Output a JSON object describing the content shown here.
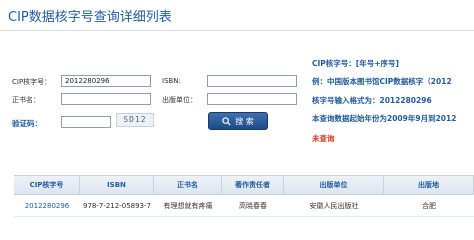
{
  "page": {
    "title": "CIP数据核字号查询详细列表"
  },
  "form": {
    "cip_label": "CIP核字号：",
    "cip_value": "2012280296",
    "isbn_label": "ISBN:",
    "isbn_value": "",
    "title_label": "正书名：",
    "title_value": "",
    "publisher_label": "出版单位：",
    "publisher_value": "",
    "verify_label": "验证码：",
    "verify_value": "",
    "captcha_text": "SD12",
    "search_label": "搜 索"
  },
  "info": {
    "line1": "CIP核字号：[年号+序号]",
    "line2": "例：中国版本图书馆CIP数据核字（2012",
    "line3": "核字号输入格式为：2012280296",
    "line4": "本查询数据起始年份为2009年9月到2012",
    "line5": "未查询"
  },
  "table": {
    "headers": [
      "CIP核字号",
      "ISBN",
      "正书名",
      "著作责任者",
      "出版单位",
      "出版地"
    ],
    "rows": [
      [
        "2012280296",
        "978-7-212-05893-7",
        "有理想就有疼痛",
        "高晓春春",
        "安徽人民出版社",
        "合肥"
      ]
    ]
  },
  "colors": {
    "accent": "#1f5b9e",
    "warning": "#d43a1b"
  }
}
